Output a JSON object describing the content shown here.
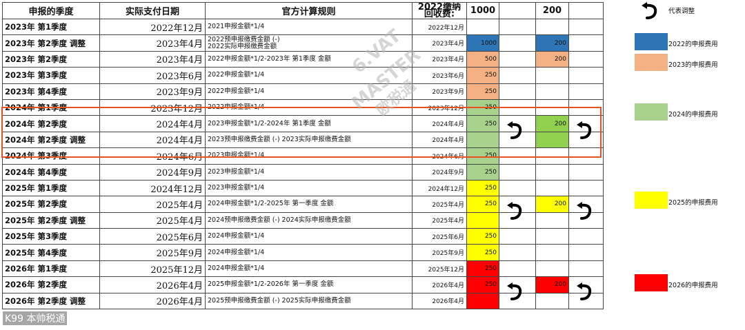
{
  "header": {
    "col_quarter": "申报的季度",
    "col_paydate": "实际支付日期",
    "col_rule": "官方计算规则",
    "col_recover": "2022缴纳回收费:",
    "col_v1000": "1000",
    "col_v200": "200"
  },
  "rows": [
    {
      "quarter": "2023年 第1季度",
      "paydate": "2022年12月",
      "rule": "2021申报金额*1/4",
      "date2": "2022年12月",
      "v1": "",
      "c1": "",
      "arrow1": false,
      "v2": "",
      "c2": "",
      "arrow2": false
    },
    {
      "quarter": "2023年 第2季度 调整",
      "paydate": "2023年4月",
      "rule": "2022预申报缴费金额 (-)\n2022实际申报缴费金额",
      "date2": "2023年4月",
      "v1": "1000",
      "c1": "#2e75b6",
      "arrow1": false,
      "v2": "200",
      "c2": "#2e75b6",
      "arrow2": false
    },
    {
      "quarter": "2023年 第2季度",
      "paydate": "2023年4月",
      "rule": "2022申报金额*1/2-2023年 第1季度 金额",
      "date2": "2023年4月",
      "v1": "500",
      "c1": "#f4b183",
      "arrow1": false,
      "v2": "200",
      "c2": "#f4b183",
      "arrow2": false
    },
    {
      "quarter": "2023年 第3季度",
      "paydate": "2023年6月",
      "rule": "2022申报金额*1/4",
      "date2": "2023年6月",
      "v1": "250",
      "c1": "#f4b183",
      "arrow1": false,
      "v2": "",
      "c2": "",
      "arrow2": false
    },
    {
      "quarter": "2023年 第4季度",
      "paydate": "2023年9月",
      "rule": "2022申报金额*1/4",
      "date2": "2023年9月",
      "v1": "250",
      "c1": "#f4b183",
      "arrow1": false,
      "v2": "",
      "c2": "",
      "arrow2": false
    },
    {
      "quarter": "2024年 第1季度",
      "paydate": "2023年12月",
      "rule": "2022申报金额*1/4",
      "date2": "2023年12月",
      "v1": "250",
      "c1": "#a9d18e",
      "arrow1": false,
      "v2": "",
      "c2": "",
      "arrow2": false
    },
    {
      "quarter": "2024年 第2季度",
      "paydate": "2024年4月",
      "rule": "2023申报金额*1/2-2024年 第1季度 金额",
      "date2": "2024年4月",
      "v1": "250",
      "c1": "#a9d18e",
      "arrow1": true,
      "v2": "200",
      "c2": "#92d050",
      "arrow2": true
    },
    {
      "quarter": "2024年 第2季度 调整",
      "paydate": "2024年4月",
      "rule": "2023预申报缴费金额 (-) 2023实际申报缴费金额",
      "date2": "2024年4月",
      "v1": "",
      "c1": "#a9d18e",
      "arrow1": false,
      "v2": "",
      "c2": "#92d050",
      "arrow2": false
    },
    {
      "quarter": "2024年 第3季度",
      "paydate": "2024年6月",
      "rule": "2023申报金额*1/4",
      "date2": "2024年6月",
      "v1": "250",
      "c1": "#a9d18e",
      "arrow1": false,
      "v2": "",
      "c2": "",
      "arrow2": false
    },
    {
      "quarter": "2024年 第4季度",
      "paydate": "2024年9月",
      "rule": "2023申报金额*1/4",
      "date2": "2024年9月",
      "v1": "250",
      "c1": "#a9d18e",
      "arrow1": false,
      "v2": "",
      "c2": "",
      "arrow2": false
    },
    {
      "quarter": "2025年 第1季度",
      "paydate": "2024年12月",
      "rule": "2023申报金额*1/4",
      "date2": "2024年12月",
      "v1": "250",
      "c1": "#ffff00",
      "arrow1": false,
      "v2": "",
      "c2": "",
      "arrow2": false
    },
    {
      "quarter": "2025年 第2季度",
      "paydate": "2025年4月",
      "rule": "2024申报金额*1/2-2025年 第一季度 金额",
      "date2": "2025年4月",
      "v1": "250",
      "c1": "#ffff00",
      "arrow1": true,
      "v2": "200",
      "c2": "#ffff00",
      "arrow2": true
    },
    {
      "quarter": "2025年 第2季度 调整",
      "paydate": "2025年4月",
      "rule": "2024预申报缴费金额 (-) 2024实际申报缴费金额",
      "date2": "2025年4月",
      "v1": "",
      "c1": "#ffff00",
      "arrow1": false,
      "v2": "",
      "c2": "",
      "arrow2": false
    },
    {
      "quarter": "2025年 第3季度",
      "paydate": "2025年6月",
      "rule": "2024申报金额*1/4",
      "date2": "2025年6月",
      "v1": "250",
      "c1": "#ffff00",
      "arrow1": false,
      "v2": "",
      "c2": "",
      "arrow2": false
    },
    {
      "quarter": "2025年 第4季度",
      "paydate": "2025年9月",
      "rule": "2024申报金额*1/4",
      "date2": "2025年9月",
      "v1": "250",
      "c1": "#ffff00",
      "arrow1": false,
      "v2": "",
      "c2": "",
      "arrow2": false
    },
    {
      "quarter": "2026年 第1季度",
      "paydate": "2025年12月",
      "rule": "2024申报金额*1/4",
      "date2": "2025年12月",
      "v1": "250",
      "c1": "#ff0000",
      "arrow1": false,
      "v2": "",
      "c2": "",
      "arrow2": false
    },
    {
      "quarter": "2026年 第2季度",
      "paydate": "2026年4月",
      "rule": "2025申报金额*1/2-2026年 第一季度 金额",
      "date2": "2026年4月",
      "v1": "250",
      "c1": "#ff0000",
      "arrow1": true,
      "v2": "200",
      "c2": "#ff0000",
      "arrow2": true
    },
    {
      "quarter": "2026年 第2季度 调整",
      "paydate": "2026年4月",
      "rule": "2025预申报缴费金额 (-) 2025实际申报缴费金额",
      "date2": "2026年4月",
      "v1": "",
      "c1": "#ff0000",
      "arrow1": false,
      "v2": "",
      "c2": "",
      "arrow2": false
    }
  ],
  "legend": {
    "adjust_label": "代表调整",
    "items": [
      {
        "label": "2022的申报费用",
        "color": "#2e75b6"
      },
      {
        "label": "2023的申报费用",
        "color": "#f4b183"
      },
      {
        "label": "2024的申报费用",
        "color": "#a9d18e"
      },
      {
        "label": "2025的申报费用",
        "color": "#ffff00"
      },
      {
        "label": "2026的申报费用",
        "color": "#ff0000"
      }
    ]
  },
  "watermark": {
    "line1": "6.VAT",
    "line2": "MASTER",
    "line3": "欧税通",
    "corner": "K99 本帅税通"
  }
}
